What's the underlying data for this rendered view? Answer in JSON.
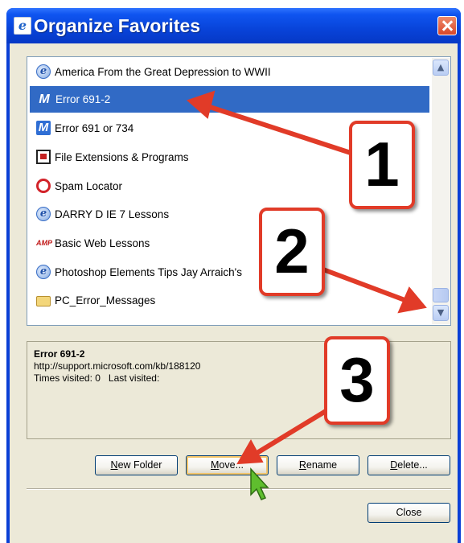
{
  "window": {
    "title": "Organize Favorites"
  },
  "favorites": [
    {
      "label": "America From the Great Depression to WWII",
      "icon": "ie-page-icon",
      "selected": false
    },
    {
      "label": "Error 691-2",
      "icon": "m-icon",
      "selected": true
    },
    {
      "label": "Error 691 or 734",
      "icon": "m-icon",
      "selected": false
    },
    {
      "label": "File Extensions & Programs",
      "icon": "file-extensions-icon",
      "selected": false
    },
    {
      "label": "Spam Locator",
      "icon": "spam-icon",
      "selected": false
    },
    {
      "label": "DARRY D IE 7 Lessons",
      "icon": "ie-page-icon",
      "selected": false
    },
    {
      "label": "Basic Web Lessons",
      "icon": "amp-logo-icon",
      "selected": false
    },
    {
      "label": "Photoshop Elements Tips Jay Arraich's",
      "icon": "ie-page-icon",
      "selected": false
    },
    {
      "label": "PC_Error_Messages",
      "icon": "folder-icon",
      "selected": false
    }
  ],
  "details": {
    "name": "Error 691-2",
    "url": "http://support.microsoft.com/kb/188120",
    "visits": "Times visited: 0   Last visited:"
  },
  "buttons": {
    "new_folder": {
      "accel": "N",
      "rest": "ew Folder"
    },
    "move": {
      "accel": "M",
      "rest": "ove..."
    },
    "rename": {
      "accel": "R",
      "rest": "ename"
    },
    "delete": {
      "accel": "D",
      "rest": "elete..."
    },
    "close": "Close"
  },
  "annotations": {
    "callout_1": "1",
    "callout_2": "2",
    "callout_3": "3"
  },
  "colors": {
    "selection": "#316ac5",
    "arrow": "#e13b28",
    "titlebar": "#0843d9",
    "dialog_face": "#ece9d8"
  }
}
